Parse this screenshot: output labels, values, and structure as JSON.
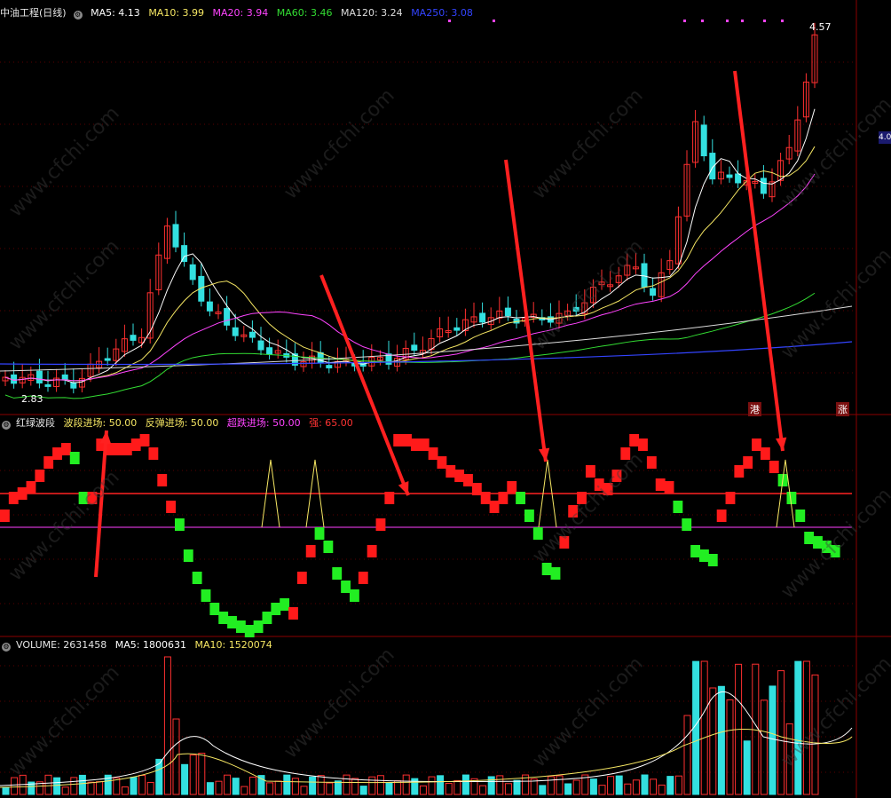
{
  "main_panel": {
    "title": "中油工程(日线)",
    "indicators": [
      {
        "label": "MA5: 4.13",
        "color": "#ffffff"
      },
      {
        "label": "MA10: 3.99",
        "color": "#f5e663"
      },
      {
        "label": "MA20: 3.94",
        "color": "#ff44ff"
      },
      {
        "label": "MA60: 3.46",
        "color": "#33dd33"
      },
      {
        "label": "MA120: 3.24",
        "color": "#dddddd"
      },
      {
        "label": "MA250: 3.08",
        "color": "#3344ff"
      }
    ],
    "high_label": "4.57",
    "low_label": "2.83",
    "price_tag": "4.0",
    "badge_gang": "港",
    "badge_zhang": "涨"
  },
  "wave_panel": {
    "title": "红绿波段",
    "indicators": [
      {
        "label": "波段进场: 50.00",
        "color": "#f5e663"
      },
      {
        "label": "反弹进场: 50.00",
        "color": "#f5e663"
      },
      {
        "label": "超跌进场: 50.00",
        "color": "#ff44ff"
      },
      {
        "label": "强: 65.00",
        "color": "#ff3333"
      }
    ]
  },
  "volume_panel": {
    "title": "VOLUME: 2631458",
    "indicators": [
      {
        "label": "MA5: 1800631",
        "color": "#ffffff"
      },
      {
        "label": "MA10: 1520074",
        "color": "#f5e663"
      }
    ]
  },
  "watermark": "www.cfchi.com",
  "colors": {
    "up": "#ff3030",
    "down": "#33e0e0",
    "wave_red": "#ff1a1a",
    "wave_green": "#22ee22"
  }
}
